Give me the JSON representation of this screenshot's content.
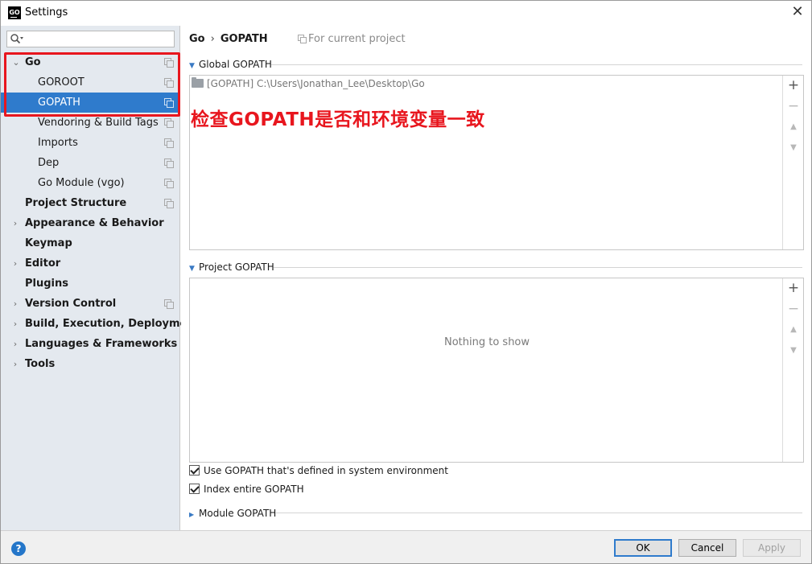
{
  "window": {
    "title": "Settings",
    "app_icon_text": "GO"
  },
  "search": {
    "placeholder": ""
  },
  "sidebar": {
    "items": [
      {
        "label": "Go",
        "bold": true,
        "expanded": true
      },
      {
        "label": "GOROOT"
      },
      {
        "label": "GOPATH",
        "selected": true
      },
      {
        "label": "Vendoring & Build Tags"
      },
      {
        "label": "Imports"
      },
      {
        "label": "Dep"
      },
      {
        "label": "Go Module (vgo)"
      },
      {
        "label": "Project Structure",
        "bold": true
      },
      {
        "label": "Appearance & Behavior",
        "bold": true
      },
      {
        "label": "Keymap",
        "bold": true
      },
      {
        "label": "Editor",
        "bold": true
      },
      {
        "label": "Plugins",
        "bold": true
      },
      {
        "label": "Version Control",
        "bold": true
      },
      {
        "label": "Build, Execution, Deployment",
        "bold": true
      },
      {
        "label": "Languages & Frameworks",
        "bold": true
      },
      {
        "label": "Tools",
        "bold": true
      }
    ]
  },
  "breadcrumb": {
    "parent": "Go",
    "separator": "›",
    "current": "GOPATH"
  },
  "scope_label": "For current project",
  "global_gopath": {
    "title": "Global GOPATH",
    "entries": [
      {
        "tag": "[GOPATH]",
        "path": "C:\\Users\\Jonathan_Lee\\Desktop\\Go"
      }
    ]
  },
  "annotation": {
    "text": "检查GOPATH是否和环境变量一致",
    "color": "#e8161e"
  },
  "project_gopath": {
    "title": "Project GOPATH",
    "empty_text": "Nothing to show"
  },
  "options": {
    "use_system_gopath": {
      "label": "Use GOPATH that's defined in system environment",
      "checked": true
    },
    "index_entire_gopath": {
      "label": "Index entire GOPATH",
      "checked": true
    }
  },
  "module_gopath": {
    "title": "Module GOPATH"
  },
  "buttons": {
    "ok": "OK",
    "cancel": "Cancel",
    "apply": "Apply",
    "help": "?"
  },
  "colors": {
    "selection": "#2f7bcc",
    "sidebar_bg": "#e4e9ef",
    "highlight": "#e8161e"
  }
}
